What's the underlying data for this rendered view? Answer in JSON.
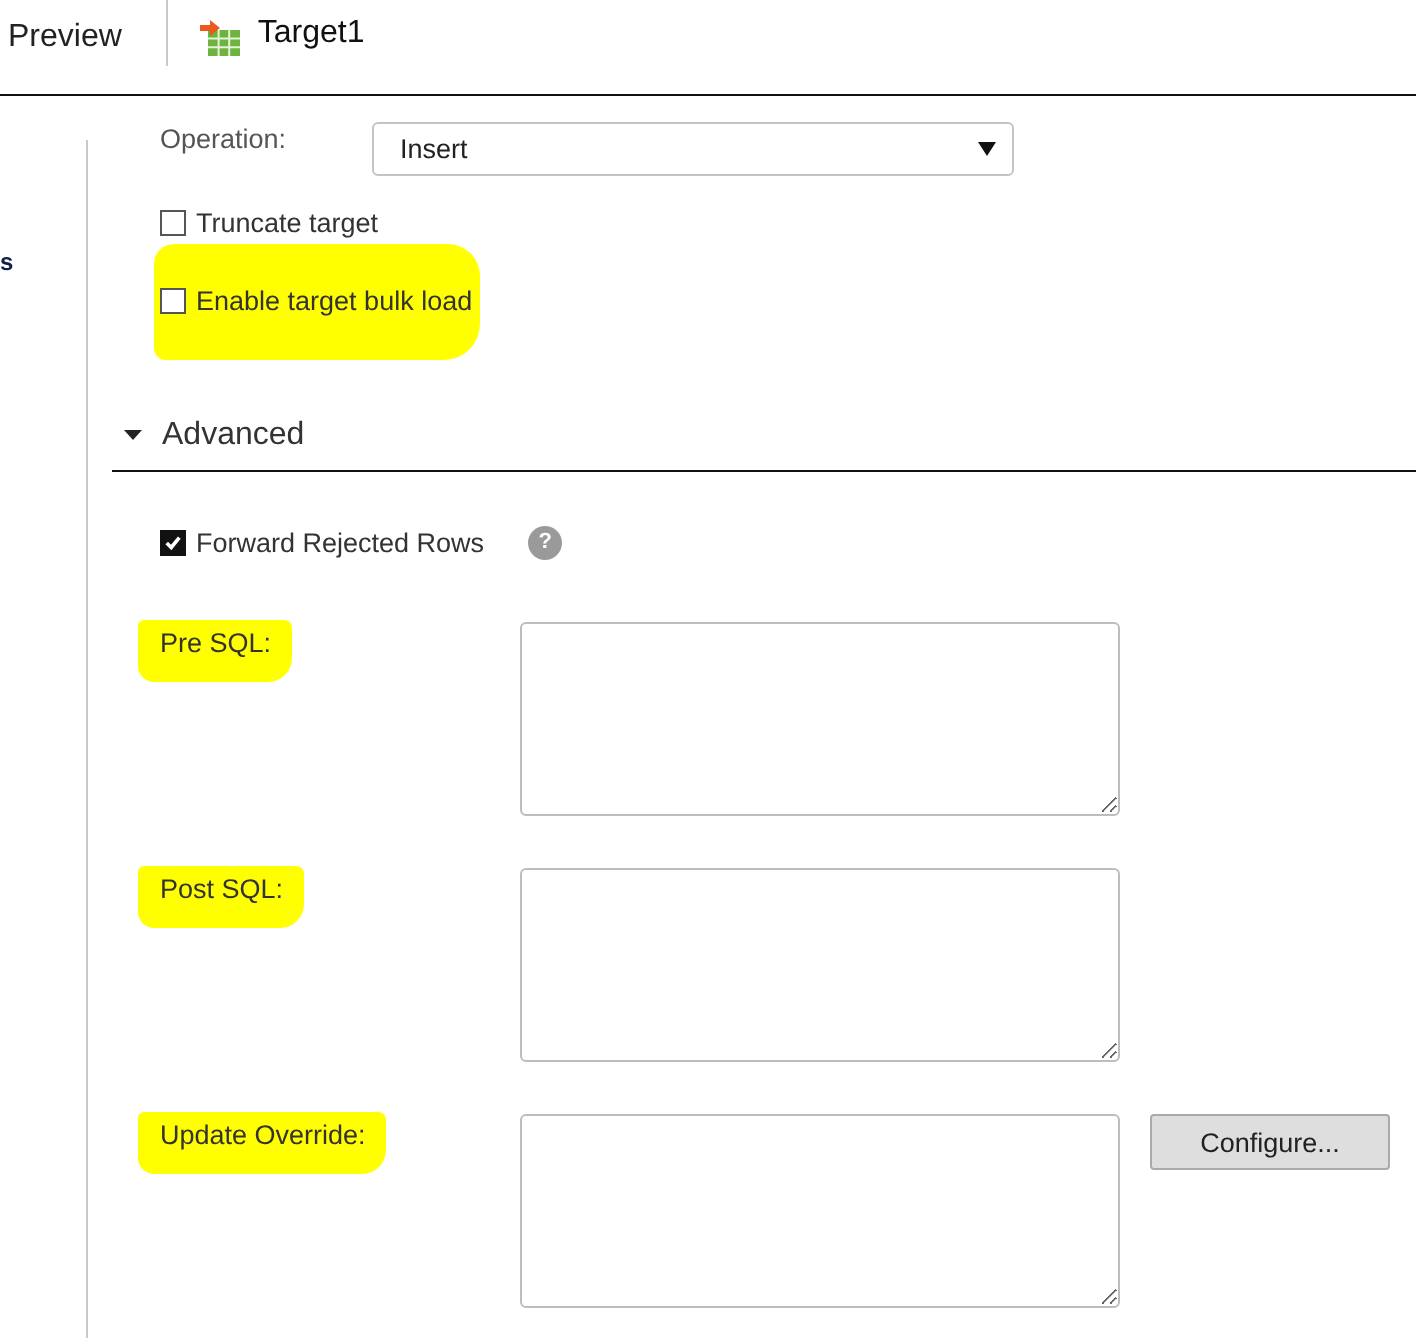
{
  "toolbar": {
    "preview_label": "Preview",
    "target": {
      "name": "Target1"
    }
  },
  "sidebar": {
    "items": [
      "s"
    ]
  },
  "operation": {
    "label": "Operation:",
    "value": "Insert"
  },
  "options": [
    {
      "label": "Truncate target",
      "checked": false,
      "highlighted": false
    },
    {
      "label": "Enable target bulk load",
      "checked": false,
      "highlighted": true
    }
  ],
  "advanced": {
    "title": "Advanced",
    "expanded": true,
    "forward_rejected_rows": {
      "label": "Forward Rejected Rows",
      "checked": true,
      "help": "?"
    },
    "sql_fields": [
      {
        "label": "Pre SQL:",
        "highlighted": true
      },
      {
        "label": "Post SQL:",
        "highlighted": true
      },
      {
        "label": "Update Override:",
        "highlighted": true,
        "button": "Configure..."
      }
    ]
  }
}
